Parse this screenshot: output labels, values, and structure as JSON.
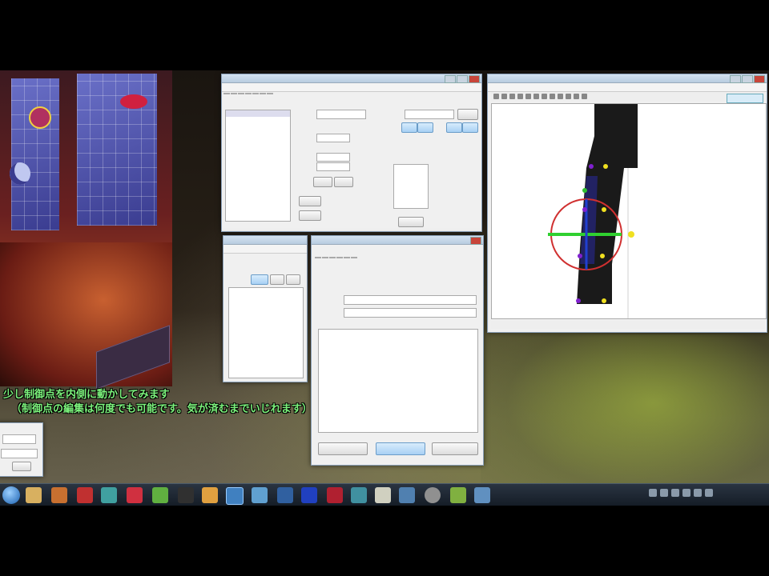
{
  "subtitle": {
    "line1": "少し制御点を内側に動かしてみます",
    "line2": "（制御点の編集は何度でも可能です。気が済むまでいじれます）"
  },
  "colors": {
    "subtitle": "#7cf27c",
    "gizmo_ring": "#d03030",
    "gizmo_axis": "#30d030",
    "control_point_yellow": "#f0e020",
    "control_point_purple": "#8020d0",
    "close_button": "#c8453a"
  },
  "icons": {
    "start": "windows-start-icon",
    "close": "close-icon",
    "maximize": "maximize-icon",
    "minimize": "minimize-icon"
  }
}
